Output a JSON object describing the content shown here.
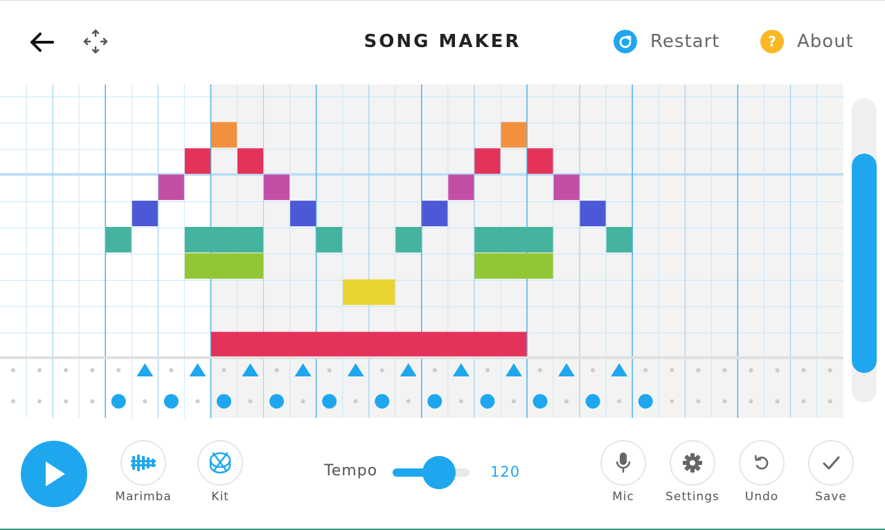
{
  "header": {
    "title": "SONG MAKER",
    "restart_label": "Restart",
    "about_label": "About",
    "about_glyph": "?"
  },
  "grid": {
    "columns": 32,
    "melody_rows": 14,
    "bar_every": 4,
    "beat_every": 2,
    "shaded_columns": [
      [
        8,
        23
      ],
      [
        24,
        31
      ]
    ],
    "notes": [
      {
        "col": 8,
        "row": 1,
        "span": 1,
        "color": "#f2903e"
      },
      {
        "col": 19,
        "row": 1,
        "span": 1,
        "color": "#f2903e"
      },
      {
        "col": 7,
        "row": 2,
        "span": 1,
        "color": "#e5325a"
      },
      {
        "col": 9,
        "row": 2,
        "span": 1,
        "color": "#e5325a"
      },
      {
        "col": 18,
        "row": 2,
        "span": 1,
        "color": "#e5325a"
      },
      {
        "col": 20,
        "row": 2,
        "span": 1,
        "color": "#e5325a"
      },
      {
        "col": 6,
        "row": 3,
        "span": 1,
        "color": "#c24ea6"
      },
      {
        "col": 10,
        "row": 3,
        "span": 1,
        "color": "#c24ea6"
      },
      {
        "col": 17,
        "row": 3,
        "span": 1,
        "color": "#c24ea6"
      },
      {
        "col": 21,
        "row": 3,
        "span": 1,
        "color": "#c24ea6"
      },
      {
        "col": 5,
        "row": 4,
        "span": 1,
        "color": "#4c59d6"
      },
      {
        "col": 11,
        "row": 4,
        "span": 1,
        "color": "#4c59d6"
      },
      {
        "col": 16,
        "row": 4,
        "span": 1,
        "color": "#4c59d6"
      },
      {
        "col": 22,
        "row": 4,
        "span": 1,
        "color": "#4c59d6"
      },
      {
        "col": 4,
        "row": 5,
        "span": 1,
        "color": "#45b39d"
      },
      {
        "col": 7,
        "row": 5,
        "span": 3,
        "color": "#45b39d"
      },
      {
        "col": 12,
        "row": 5,
        "span": 1,
        "color": "#45b39d"
      },
      {
        "col": 15,
        "row": 5,
        "span": 1,
        "color": "#45b39d"
      },
      {
        "col": 18,
        "row": 5,
        "span": 3,
        "color": "#45b39d"
      },
      {
        "col": 23,
        "row": 5,
        "span": 1,
        "color": "#45b39d"
      },
      {
        "col": 7,
        "row": 6,
        "span": 3,
        "color": "#93c635"
      },
      {
        "col": 18,
        "row": 6,
        "span": 3,
        "color": "#93c635"
      },
      {
        "col": 13,
        "row": 7,
        "span": 2,
        "color": "#e8d432"
      },
      {
        "col": 8,
        "row": 9,
        "span": 12,
        "color": "#e5325a"
      }
    ],
    "triangle_beats": [
      5,
      7,
      9,
      11,
      13,
      15,
      17,
      19,
      21,
      23
    ],
    "circle_beats": [
      4,
      6,
      8,
      10,
      12,
      14,
      16,
      18,
      20,
      22,
      24
    ]
  },
  "controls": {
    "instrument_label": "Marimba",
    "kit_label": "Kit",
    "tempo_label": "Tempo",
    "tempo_value": "120",
    "tempo_fraction": 0.6,
    "mic_label": "Mic",
    "settings_label": "Settings",
    "undo_label": "Undo",
    "save_label": "Save"
  },
  "scroll": {
    "position_fraction": 0.65,
    "visible_fraction": 0.72
  },
  "colors": {
    "accent": "#1ea7ee",
    "about": "#f9b723",
    "grid_line": "#c8e6f9",
    "beat_line": "#9ed2f3",
    "bar_line": "#56b4ec",
    "shade": "#f3f3f3"
  },
  "icons": {
    "back": "arrow-left-icon",
    "move": "move-arrows-icon",
    "restart": "restart-icon",
    "about": "question-icon",
    "play": "play-icon",
    "marimba": "marimba-icon",
    "kit": "drum-kit-icon",
    "mic": "microphone-icon",
    "settings": "gear-icon",
    "undo": "undo-icon",
    "save": "checkmark-icon"
  }
}
